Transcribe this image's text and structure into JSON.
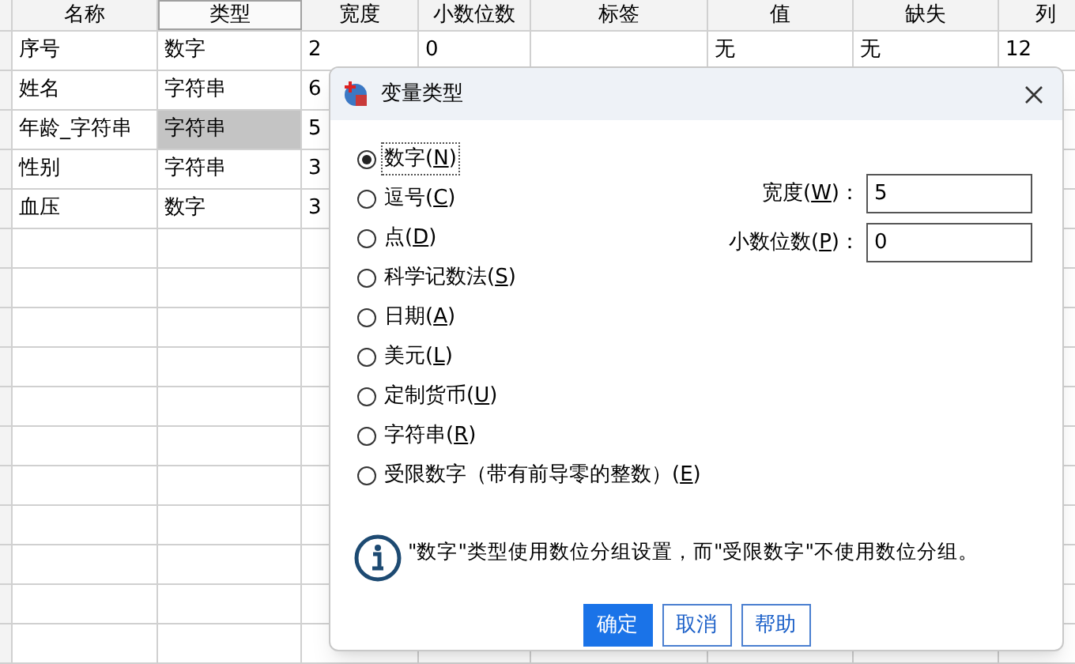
{
  "grid": {
    "columns": [
      {
        "label": "名称",
        "selected": false
      },
      {
        "label": "类型",
        "selected": true
      },
      {
        "label": "宽度",
        "selected": false
      },
      {
        "label": "小数位数",
        "selected": false
      },
      {
        "label": "标签",
        "selected": false
      },
      {
        "label": "值",
        "selected": false
      },
      {
        "label": "缺失",
        "selected": false
      },
      {
        "label": "列",
        "selected": false
      }
    ],
    "rows": [
      {
        "cells": [
          "序号",
          "数字",
          "2",
          "0",
          "",
          "无",
          "无",
          "12"
        ],
        "type_selected": false
      },
      {
        "cells": [
          "姓名",
          "字符串",
          "6"
        ],
        "type_selected": false
      },
      {
        "cells": [
          "年龄_字符串",
          "字符串",
          "5"
        ],
        "type_selected": true
      },
      {
        "cells": [
          "性别",
          "字符串",
          "3"
        ],
        "type_selected": false
      },
      {
        "cells": [
          "血压",
          "数字",
          "3"
        ],
        "type_selected": false
      }
    ]
  },
  "dialog": {
    "title": "变量类型",
    "options": [
      {
        "before": "数字(",
        "key": "N",
        "after": ")",
        "selected": true
      },
      {
        "before": "逗号(",
        "key": "C",
        "after": ")",
        "selected": false
      },
      {
        "before": "点(",
        "key": "D",
        "after": ")",
        "selected": false
      },
      {
        "before": "科学记数法(",
        "key": "S",
        "after": ")",
        "selected": false
      },
      {
        "before": "日期(",
        "key": "A",
        "after": ")",
        "selected": false
      },
      {
        "before": "美元(",
        "key": "L",
        "after": ")",
        "selected": false
      },
      {
        "before": "定制货币(",
        "key": "U",
        "after": ")",
        "selected": false
      },
      {
        "before": "字符串(",
        "key": "R",
        "after": ")",
        "selected": false
      },
      {
        "before": "受限数字（带有前导零的整数）(",
        "key": "E",
        "after": ")",
        "selected": false
      }
    ],
    "fields": [
      {
        "before": "宽度(",
        "key": "W",
        "after": ")：",
        "value": "5"
      },
      {
        "before": "小数位数(",
        "key": "P",
        "after": ")：",
        "value": "0"
      }
    ],
    "info": "\"数字\"类型使用数位分组设置，而\"受限数字\"不使用数位分组。",
    "buttons": [
      {
        "label": "确定",
        "kind": "primary"
      },
      {
        "label": "取消",
        "kind": "secondary"
      },
      {
        "label": "帮助",
        "kind": "secondary"
      }
    ]
  }
}
